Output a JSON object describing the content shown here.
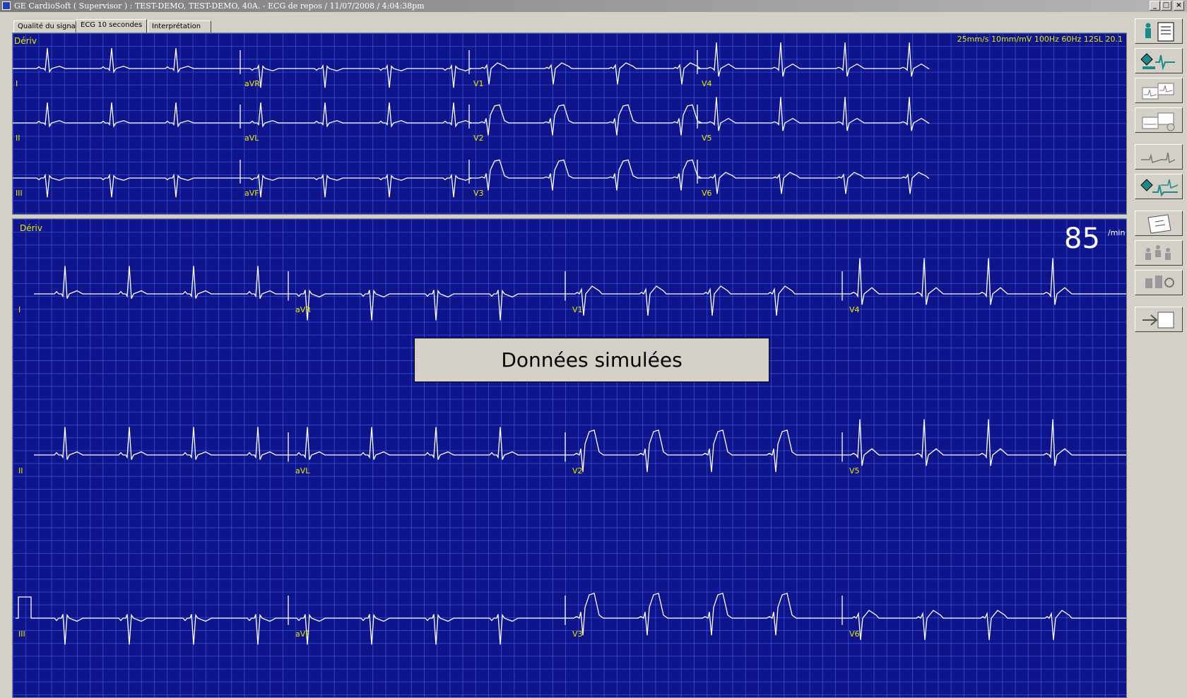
{
  "window": {
    "title": "GE CardioSoft ( Supervisor ) : TEST-DEMO, TEST-DEMO, 40A.  - ECG de repos / 11/07/2008 /  4:04:38pm",
    "controls": {
      "minimize": "_",
      "maximize": "□",
      "close": "×"
    }
  },
  "tabs": [
    {
      "label": "Qualité du signal",
      "active": false
    },
    {
      "label": "ECG 10 secondes",
      "active": true
    },
    {
      "label": "Interprétation",
      "active": false
    }
  ],
  "top_panel": {
    "title": "Dériv",
    "settings": "25mm/s  10mm/mV  100Hz  60Hz  12SL 20.1",
    "leads": [
      "I",
      "aVR",
      "V1",
      "V4",
      "II",
      "aVL",
      "V2",
      "V5",
      "III",
      "aVF",
      "V3",
      "V6"
    ]
  },
  "bottom_panel": {
    "title": "Dériv",
    "heart_rate": "85",
    "heart_rate_unit": "/min",
    "leads": [
      "I",
      "aVR",
      "V1",
      "V4",
      "II",
      "aVL",
      "V2",
      "V5",
      "III",
      "aVF",
      "V3",
      "V6"
    ],
    "overlay_label": "Données simulées"
  },
  "toolbar": [
    {
      "name": "patient-report-icon"
    },
    {
      "name": "acquire-ecg-icon"
    },
    {
      "name": "compare-ecg-icon"
    },
    {
      "name": "ecg-filter-icon"
    },
    {
      "name": "rhythm-strip-icon"
    },
    {
      "name": "stress-ecg-icon"
    },
    {
      "name": "open-folder-icon"
    },
    {
      "name": "patient-list-icon"
    },
    {
      "name": "settings-icon"
    },
    {
      "name": "exit-icon"
    }
  ],
  "colors": {
    "grid_bg": "#10148a",
    "grid_line": "#3c6eff",
    "trace": "#ffffff",
    "label": "#e8e800"
  }
}
